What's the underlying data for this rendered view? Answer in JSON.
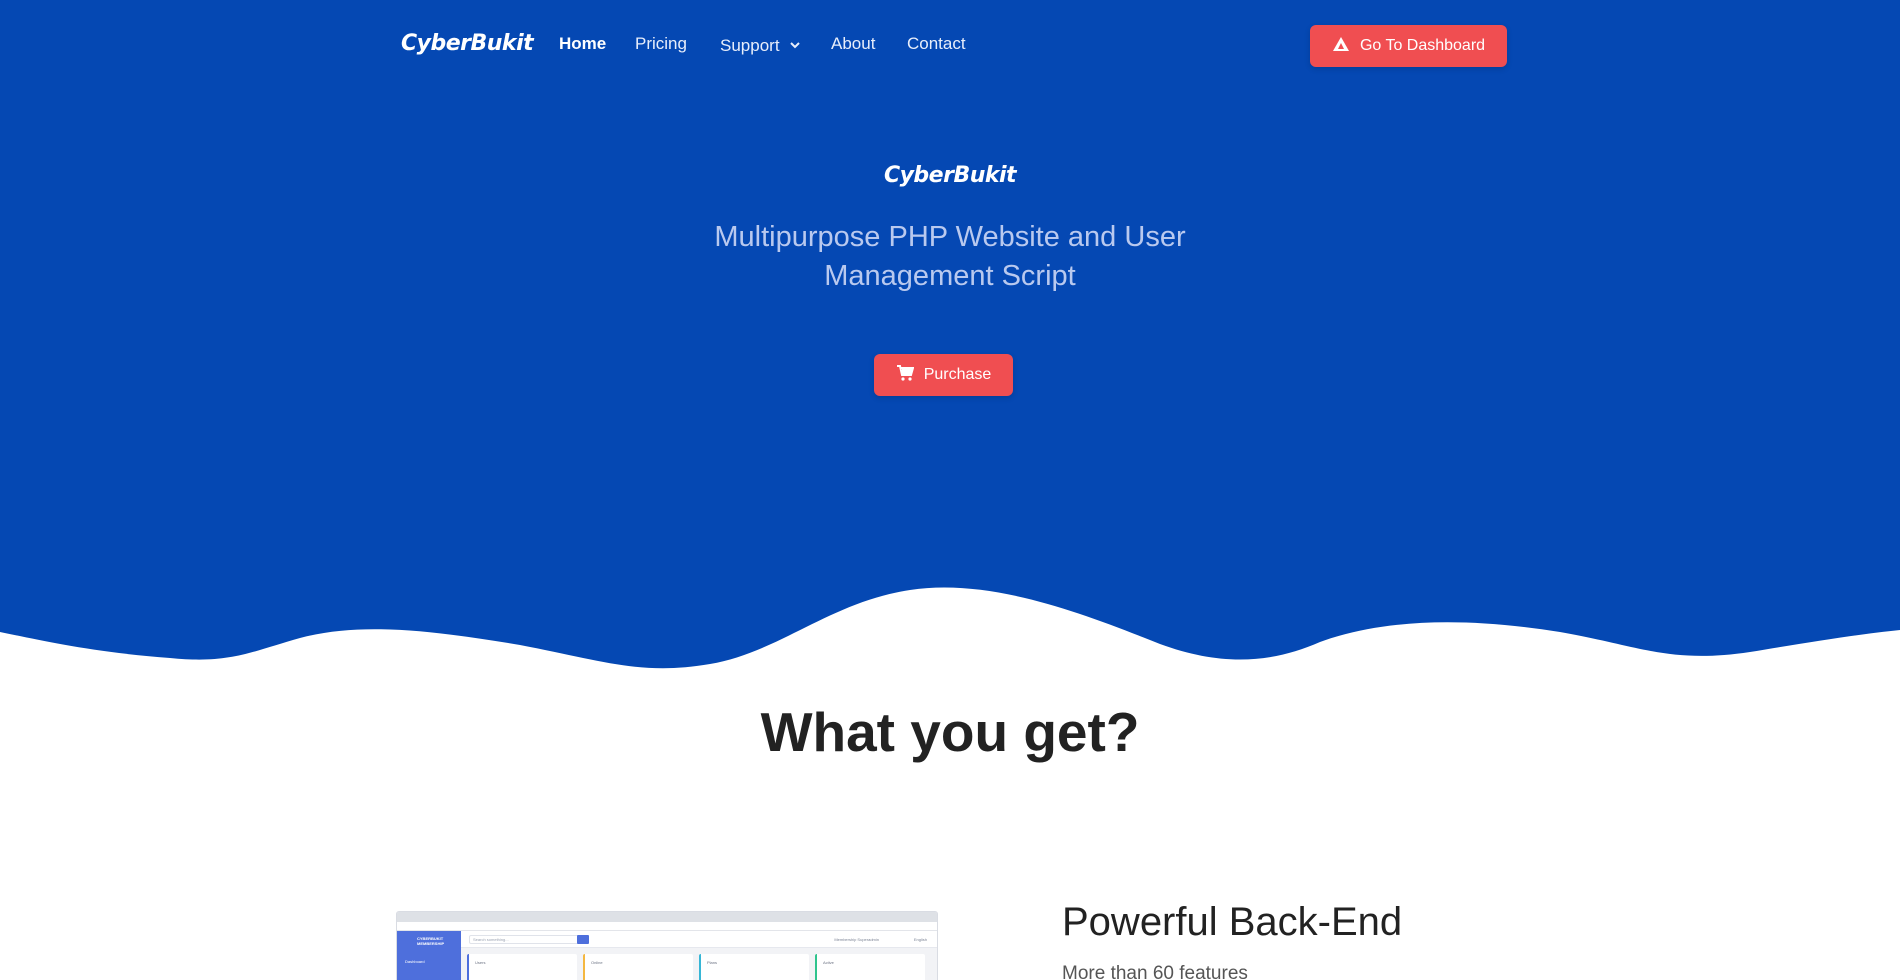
{
  "nav": {
    "brand": "CyberBukit",
    "links": {
      "home": "Home",
      "pricing": "Pricing",
      "support": "Support",
      "about": "About",
      "contact": "Contact"
    },
    "dashboard_button": "Go To Dashboard"
  },
  "hero": {
    "brand": "CyberBukit",
    "subtitle": "Multipurpose PHP Website and User Management Script",
    "purchase_button": "Purchase"
  },
  "section": {
    "title": "What you get?"
  },
  "feature": {
    "title": "Powerful Back-End",
    "subtitle": "More than 60 features",
    "preview": {
      "sidebar_title": "CYBERBUKIT MEMBERSHIP",
      "sidebar_item": "Dashboard",
      "search_placeholder": "Search something...",
      "user": "Membership Superadmin",
      "language": "English",
      "cards": [
        "Users",
        "Online",
        "Plans",
        "Active"
      ]
    }
  },
  "colors": {
    "hero_background": "#0548b3",
    "accent_button": "#f04e51",
    "text_dark": "#222222"
  },
  "icons": {
    "support_dropdown": "chevron-down-icon",
    "dashboard": "triangle-logo-icon",
    "purchase": "shopping-cart-icon"
  }
}
